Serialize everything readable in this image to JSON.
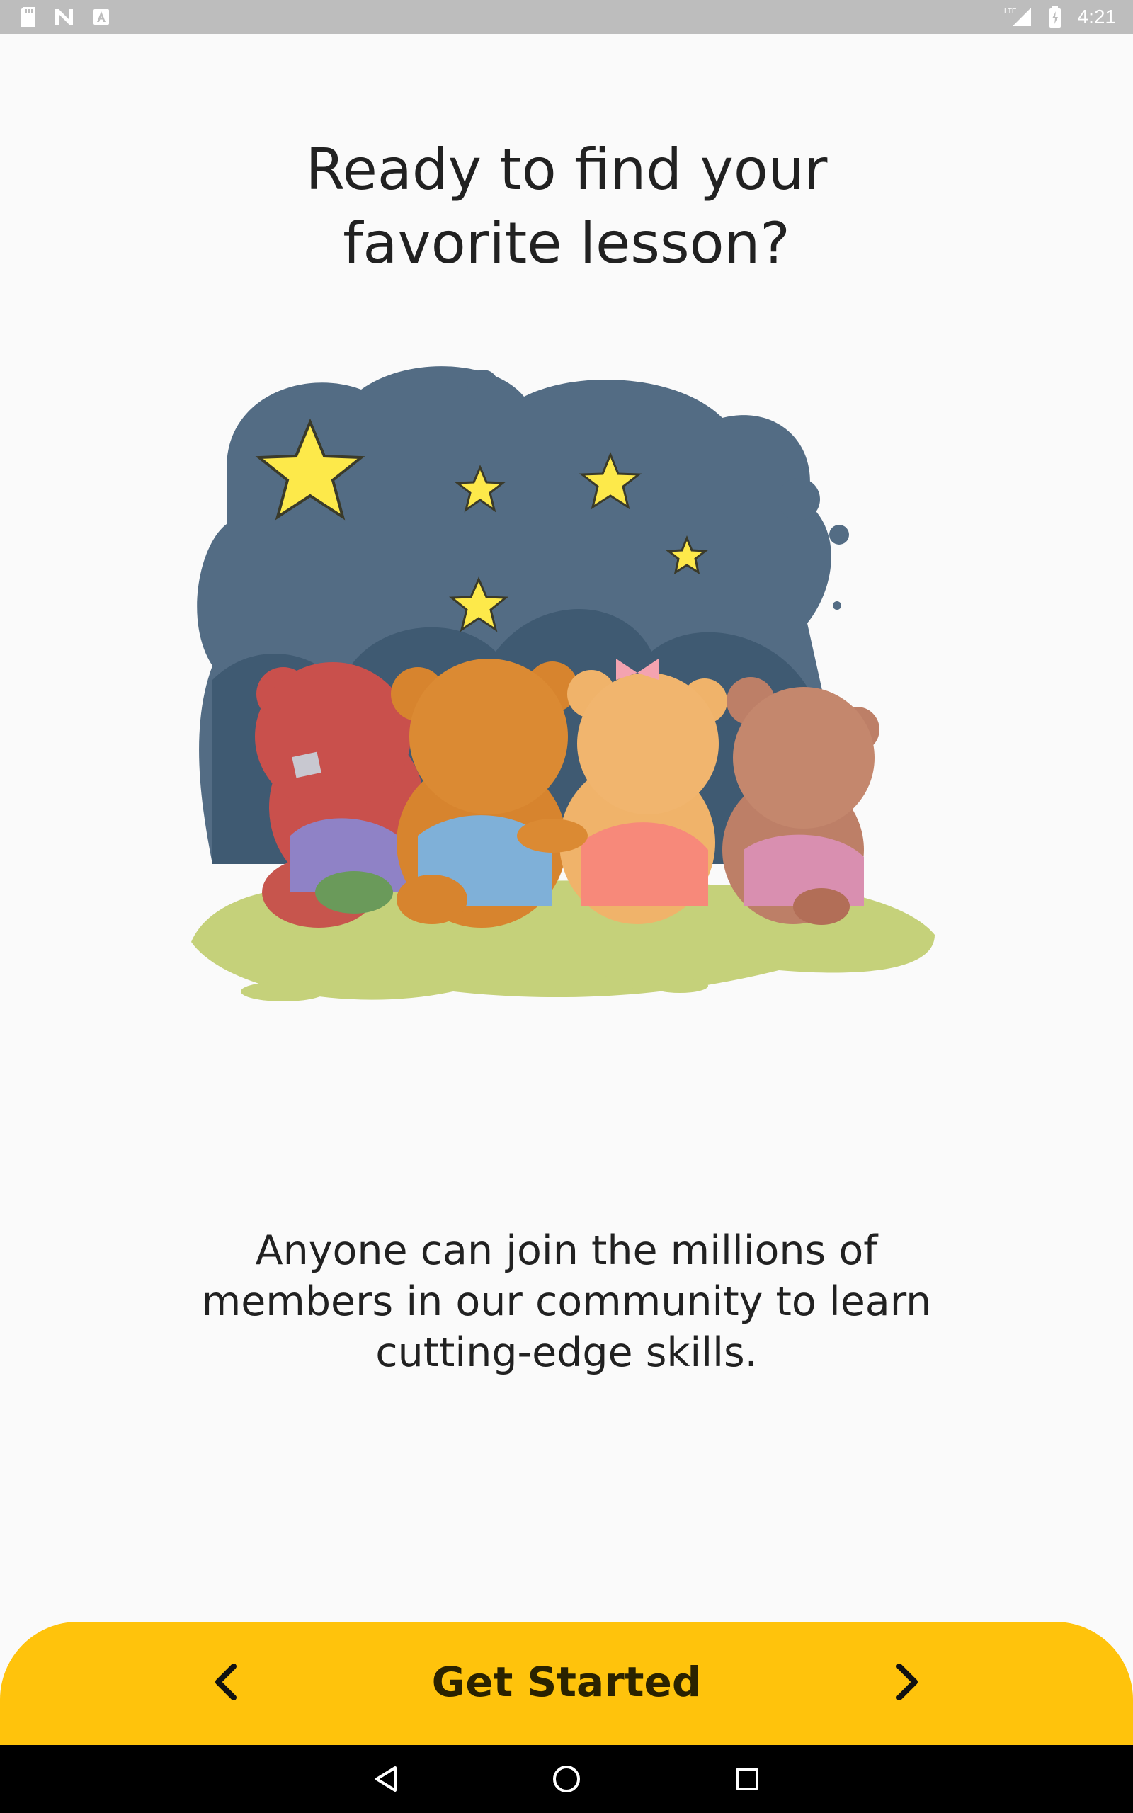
{
  "status_bar": {
    "time": "4:21",
    "left_icons": [
      "sd-card-icon",
      "n-notification-icon",
      "a-notification-icon"
    ],
    "right_icons": [
      "lte-signal-icon",
      "battery-charging-icon"
    ],
    "lte_label": "LTE"
  },
  "onboarding": {
    "title_line1": "Ready to find your",
    "title_line2": "favorite lesson?",
    "illustration": "teddy-bears-stargazing-illustration",
    "body_line1": "Anyone can join the millions of",
    "body_line2": "members in our community to learn",
    "body_line3": "cutting-edge skills."
  },
  "bottom_bar": {
    "cta_label": "Get Started",
    "prev_icon": "chevron-left-icon",
    "next_icon": "chevron-right-icon",
    "color": "#ffc30c"
  },
  "nav_bar": {
    "buttons": [
      "back-triangle-icon",
      "home-circle-icon",
      "recents-square-icon"
    ]
  },
  "colors": {
    "background": "#fafafa",
    "text": "#212121",
    "night_sky": "#536c84",
    "grass": "#c5d17a"
  }
}
